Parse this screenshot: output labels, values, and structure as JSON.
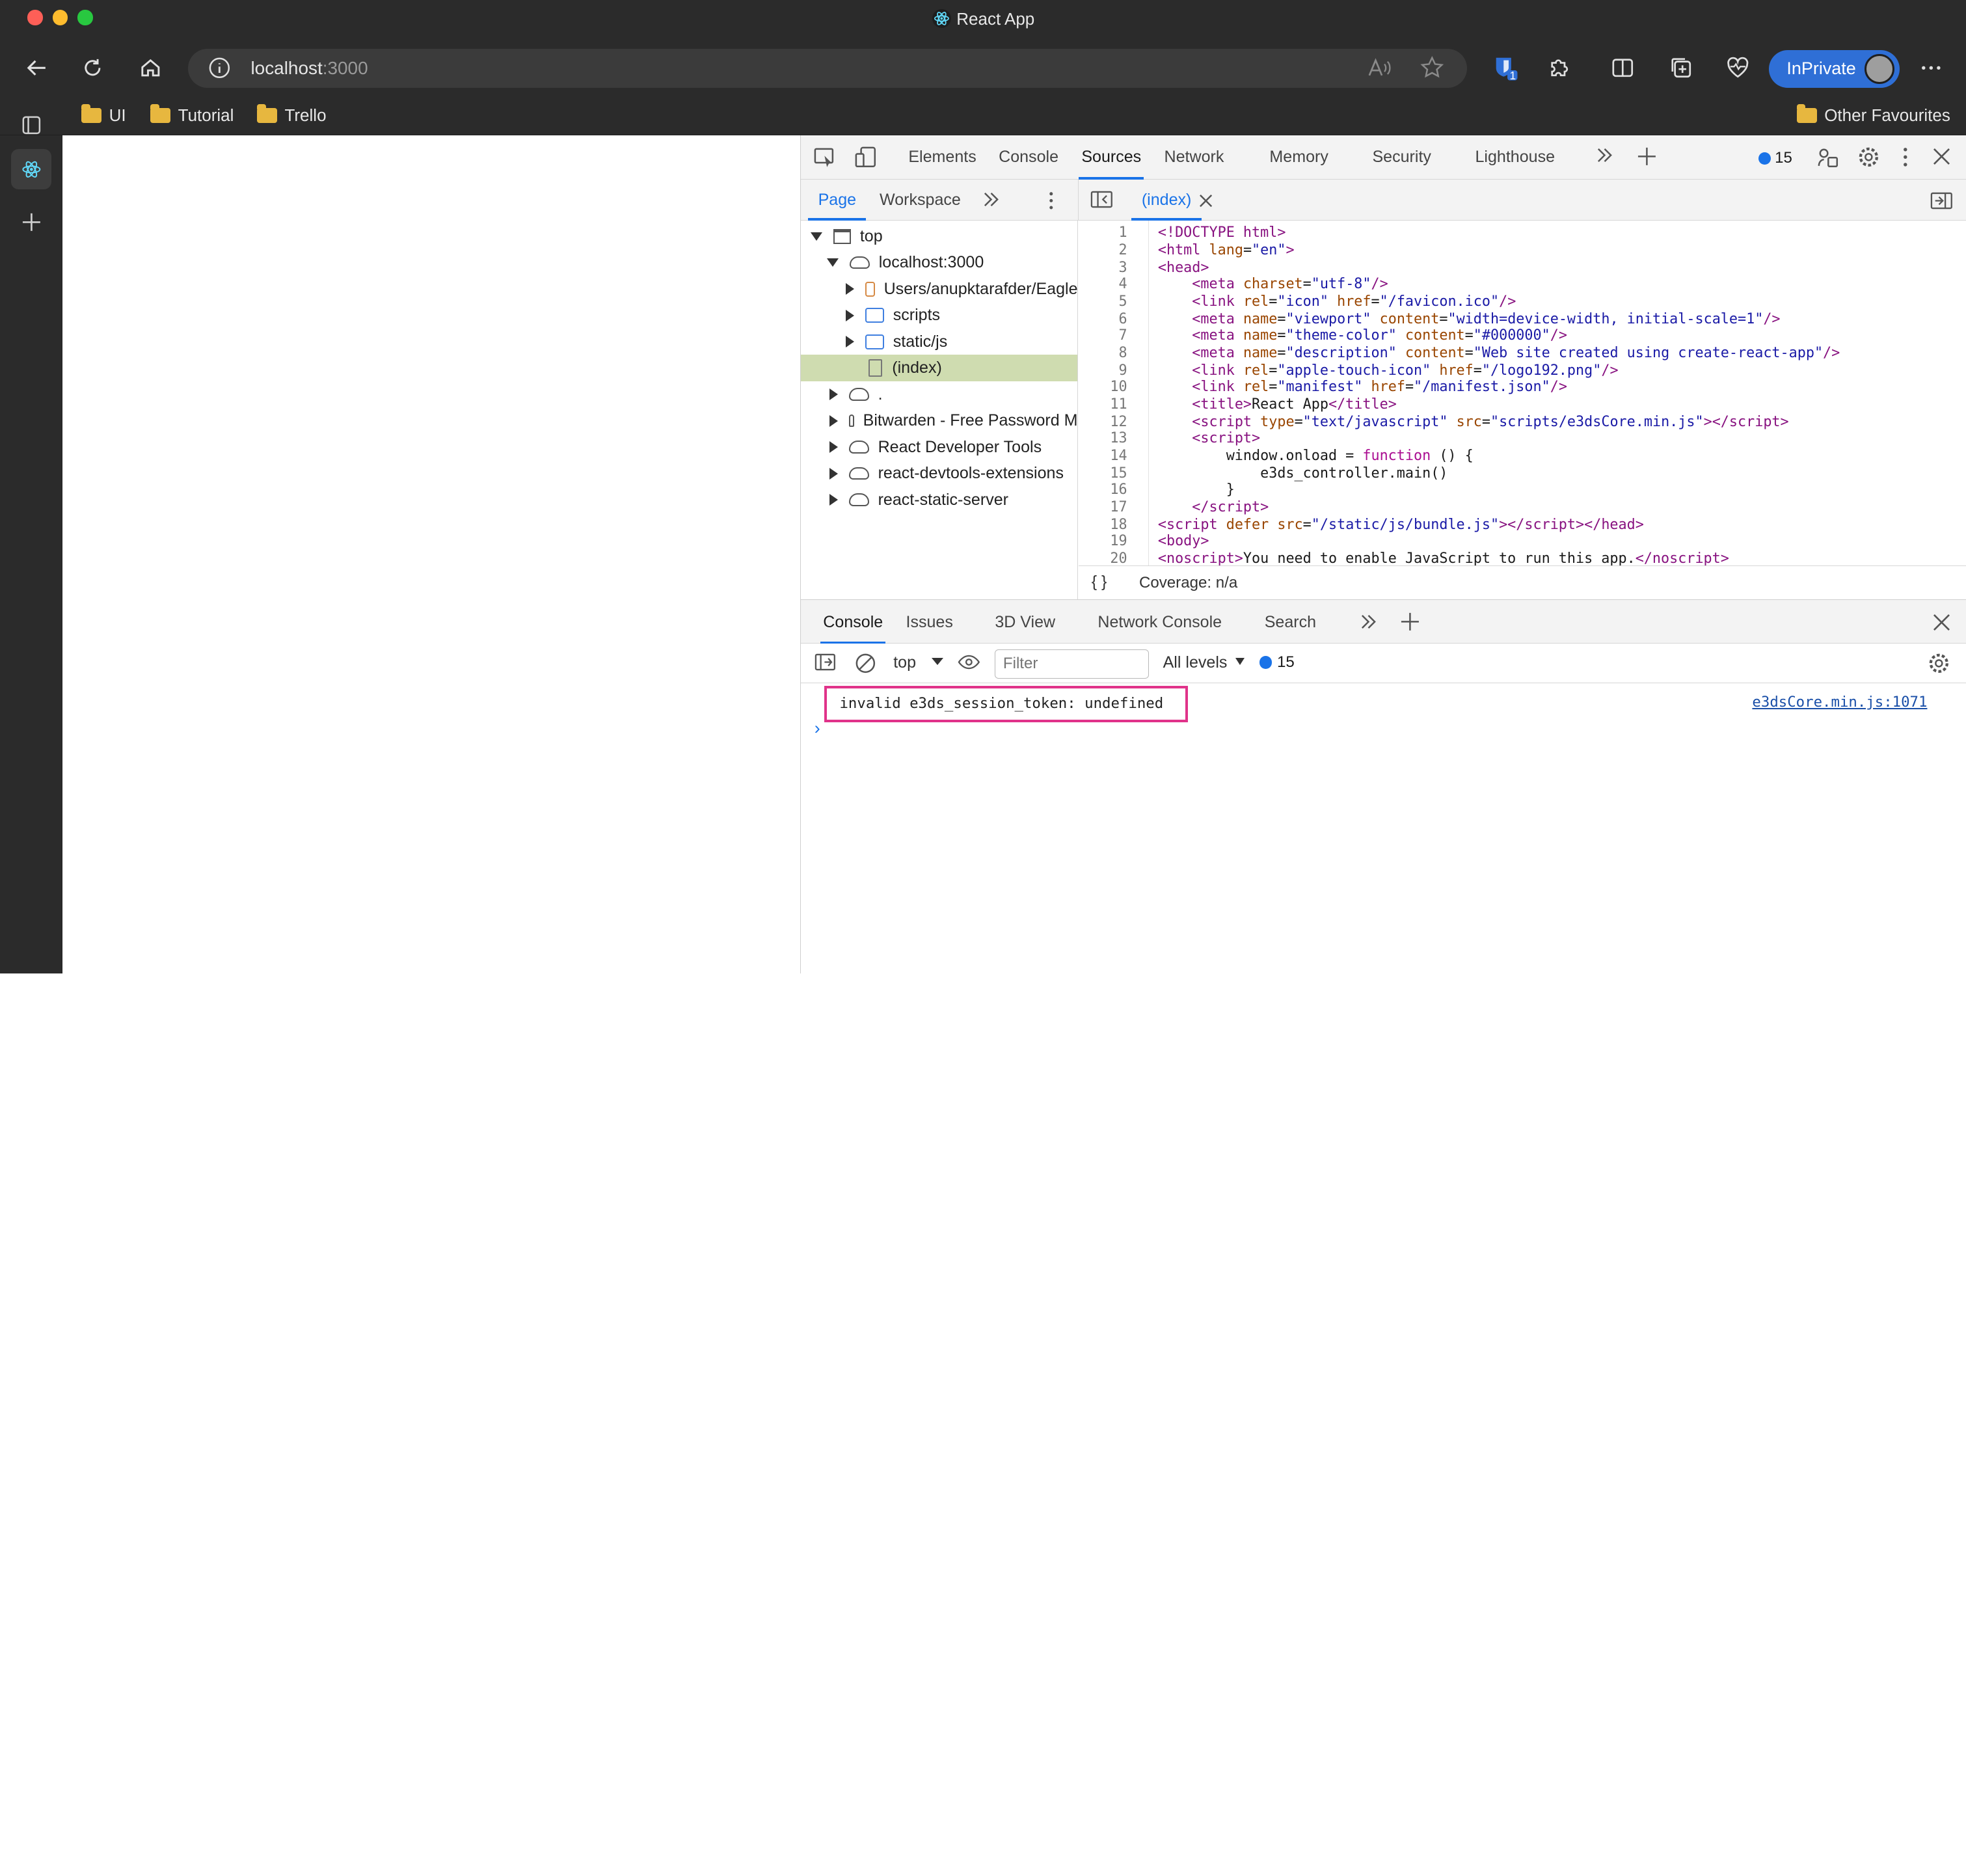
{
  "window": {
    "title": "React App",
    "traffic_lights": [
      "#fe5f57",
      "#febc2e",
      "#28c840"
    ]
  },
  "toolbar": {
    "url_host": "localhost",
    "url_port": ":3000",
    "inprivate_label": "InPrivate",
    "extension_badge": "1"
  },
  "favourites": {
    "items": [
      {
        "label": "UI"
      },
      {
        "label": "Tutorial"
      },
      {
        "label": "Trello"
      }
    ],
    "other": "Other Favourites"
  },
  "devtools": {
    "main_tabs": [
      "Elements",
      "Console",
      "Sources",
      "Network",
      "Memory",
      "Security",
      "Lighthouse"
    ],
    "active_tab": "Sources",
    "message_count": "15",
    "navigator_tabs": [
      "Page",
      "Workspace"
    ],
    "open_file": "(index)",
    "tree": [
      {
        "label": "top"
      },
      {
        "label": "localhost:3000"
      },
      {
        "label": "Users/anupktarafder/Eagle"
      },
      {
        "label": "scripts"
      },
      {
        "label": "static/js"
      },
      {
        "label": "(index)"
      },
      {
        "label": "."
      },
      {
        "label": "Bitwarden - Free Password M"
      },
      {
        "label": "React Developer Tools"
      },
      {
        "label": "react-devtools-extensions"
      },
      {
        "label": "react-static-server"
      }
    ],
    "line_numbers": [
      "1",
      "2",
      "3",
      "4",
      "5",
      "6",
      "7",
      "8",
      "9",
      "10",
      "11",
      "12",
      "13",
      "14",
      "15",
      "16",
      "17",
      "18",
      "19",
      "20"
    ],
    "coverage": "Coverage: n/a",
    "format_icon": "{ }",
    "drawer_tabs": [
      "Console",
      "Issues",
      "3D View",
      "Network Console",
      "Search"
    ],
    "context": "top",
    "filter_placeholder": "Filter",
    "levels": "All levels",
    "drawer_count": "15",
    "console_message": "invalid e3ds_session_token: undefined",
    "console_source": "e3dsCore.min.js:1071",
    "prompt": "›"
  },
  "colors": {
    "chrome_dark": "#2b2b2b",
    "accent": "#1a73e8",
    "inprivate": "#2f6fd6",
    "highlight_border": "#e0338a",
    "selected_row": "#cfdcb0"
  }
}
